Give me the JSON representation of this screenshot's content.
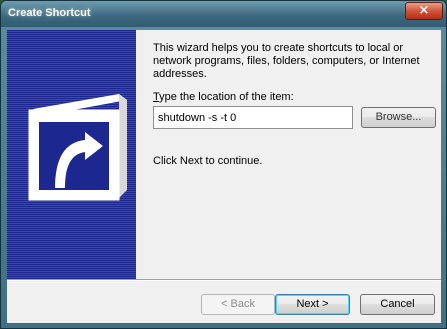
{
  "window": {
    "title": "Create Shortcut",
    "close_glyph": "×"
  },
  "icons": {
    "close": "close-icon",
    "wizard_graphic": "shortcut-arrow-icon"
  },
  "content": {
    "description": "This wizard helps you to create shortcuts to local or network programs, files, folders, computers, or Internet addresses.",
    "location_label": "Type the location of the item:",
    "location_value": "shutdown -s -t 0",
    "browse_label": "Browse...",
    "next_hint": "Click Next to continue."
  },
  "footer": {
    "back_label": "< Back",
    "next_label": "Next >",
    "cancel_label": "Cancel"
  },
  "colors": {
    "banner": "#1d2790",
    "close_button": "#c53a1e",
    "dialog_background": "#f0f0f0"
  }
}
